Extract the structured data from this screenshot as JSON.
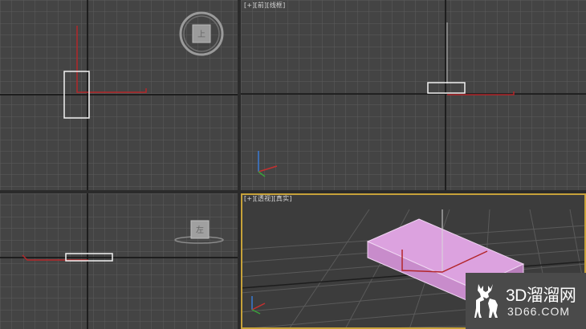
{
  "viewports": {
    "top_right_label": {
      "plus": "[+]",
      "view": "[前]",
      "shading": "[线框]"
    },
    "bottom_right_label": {
      "plus": "[+]",
      "view": "[透视]",
      "shading": "[真实]"
    }
  },
  "viewcube": {
    "top_face": "上",
    "left_face": "左"
  },
  "watermark": {
    "line1": "3D溜溜网",
    "line2": "3D66.COM"
  },
  "colors": {
    "grid": "#5a5a5a",
    "axis": "#111111",
    "object_wire": "#f0f0f0",
    "pivot": "#b3262a",
    "box": "#d9a1dc",
    "active_border": "#c7a23a"
  }
}
